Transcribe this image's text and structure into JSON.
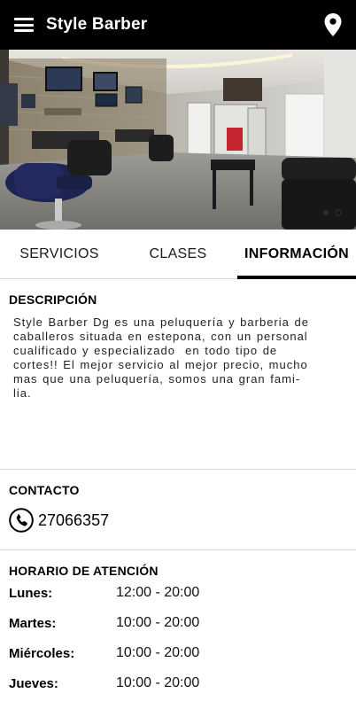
{
  "app": {
    "title": "Style Barber"
  },
  "icons": {
    "menu": "hamburger-menu-icon",
    "location": "map-pin-icon",
    "phone": "phone-icon"
  },
  "tabs": [
    {
      "label": "SERVICIOS",
      "active": false
    },
    {
      "label": "CLASES",
      "active": false
    },
    {
      "label": "INFORMACIÓN",
      "active": true
    }
  ],
  "hero": {
    "carousel_pages": 2,
    "current_page": 1
  },
  "description": {
    "title": "DESCRIPCIÓN",
    "lines": [
      "Style Barber Dg es una peluquería y barberia de",
      "caballeros situada en estepona, con un personal",
      "cualificado y especializado  en todo tipo de",
      "cortes!! El mejor servicio al mejor precio, mucho",
      "mas que una peluquería, somos una gran fami-",
      "lia."
    ]
  },
  "contact": {
    "title": "CONTACTO",
    "phone": "27066357"
  },
  "hours": {
    "title": "HORARIO DE ATENCIÓN",
    "rows": [
      {
        "day": "Lunes:",
        "time": "12:00 - 20:00"
      },
      {
        "day": "Martes:",
        "time": "10:00 - 20:00"
      },
      {
        "day": "Miércoles:",
        "time": "10:00 - 20:00"
      },
      {
        "day": "Jueves:",
        "time": "10:00 - 20:00"
      }
    ]
  },
  "colors": {
    "appbar": "#000000",
    "accent": "#000000",
    "divider": "#d6d6d6"
  }
}
